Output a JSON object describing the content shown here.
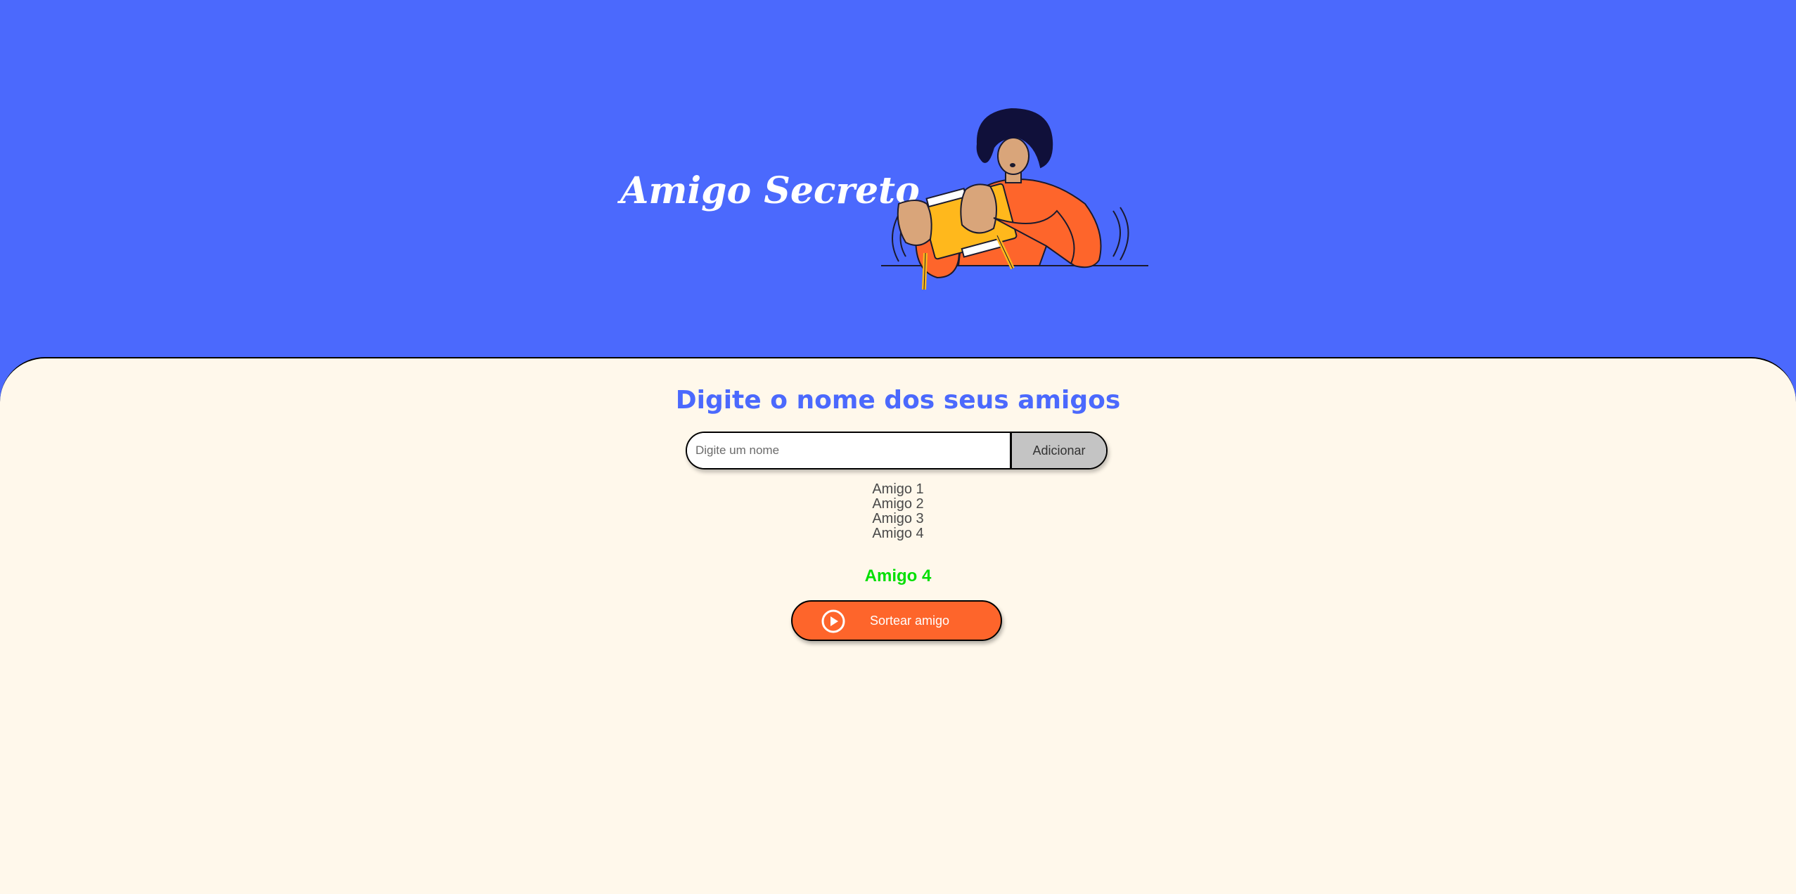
{
  "header": {
    "title": "Amigo Secreto",
    "illustration_icon": "person-with-gift-illustration"
  },
  "main": {
    "section_title": "Digite o nome dos seus amigos",
    "input": {
      "placeholder": "Digite um nome",
      "value": ""
    },
    "add_button_label": "Adicionar",
    "friends": [
      "Amigo 1",
      "Amigo 2",
      "Amigo 3",
      "Amigo 4"
    ],
    "result": "Amigo 4",
    "draw_button": {
      "label": "Sortear amigo",
      "icon": "play-icon"
    }
  },
  "colors": {
    "header_bg": "#4b69fd",
    "main_bg": "#fff8eb",
    "title_accent": "#4b69fd",
    "result_green": "#05df05",
    "draw_button_bg": "#fe652b",
    "add_button_bg": "#c4c4c4"
  }
}
